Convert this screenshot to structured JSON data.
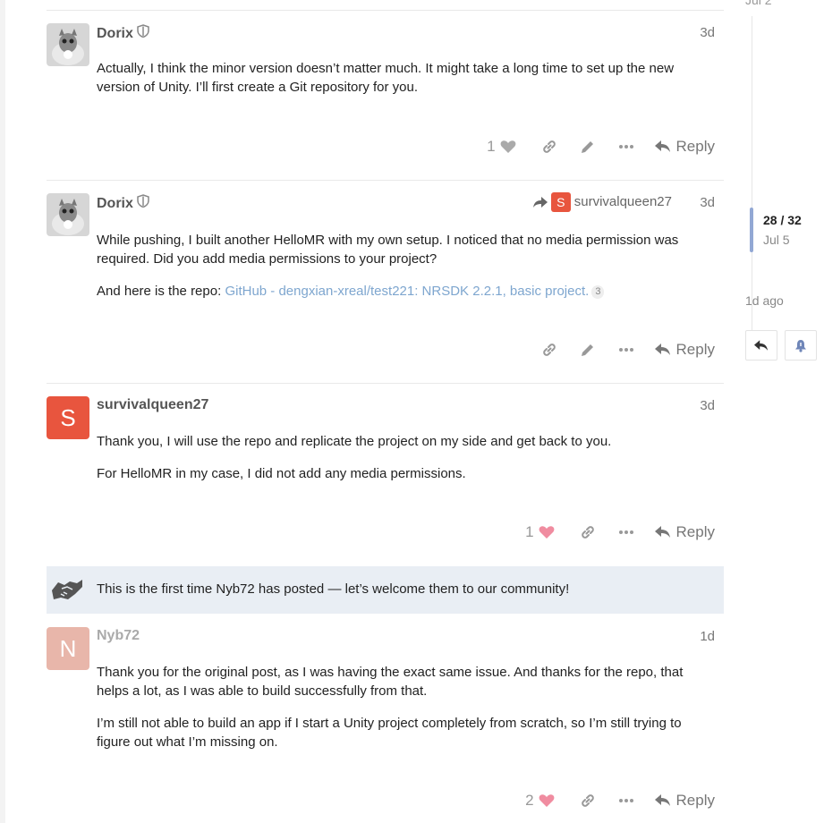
{
  "timeline": {
    "top_date": "Jul 2",
    "count": "28 / 32",
    "date": "Jul 5",
    "last_activity": "1d ago"
  },
  "posts": [
    {
      "username": "Dorix",
      "date": "3d",
      "paragraphs": [
        "Actually, I think the minor version doesn’t matter much. It might take a long time to set up the new version of Unity. I’ll first create a Git repository for you."
      ],
      "likes": "1",
      "reply_label": "Reply"
    },
    {
      "username": "Dorix",
      "date": "3d",
      "reply_to": {
        "initial": "S",
        "username": "survivalqueen27"
      },
      "paragraphs": [
        "While pushing, I built another HelloMR with my own setup. I noticed that no media permission was required. Did you add media permissions to your project?"
      ],
      "repo_prefix": "And here is the repo: ",
      "repo_link": "GitHub - dengxian-xreal/test221: NRSDK 2.2.1, basic project.",
      "repo_clicks": "3",
      "reply_label": "Reply"
    },
    {
      "username": "survivalqueen27",
      "avatar_letter": "S",
      "date": "3d",
      "paragraphs": [
        "Thank you, I will use the repo and replicate the project on my side and get back to you.",
        "For HelloMR in my case, I did not add any media permissions."
      ],
      "likes": "1",
      "reply_label": "Reply"
    },
    {
      "username": "Nyb72",
      "avatar_letter": "N",
      "date": "1d",
      "paragraphs": [
        "Thank you for the original post, as I was having the exact same issue. And thanks for the repo, that helps a lot, as I was able to build successfully from that.",
        "I’m still not able to build an app if I start a Unity project completely from scratch, so I’m still trying to figure out what I’m missing on."
      ],
      "likes": "2",
      "reply_label": "Reply"
    }
  ],
  "first_post_notice": "This is the first time Nyb72 has posted — let’s welcome them to our community!",
  "colors": {
    "accent_red": "#e8553e",
    "avatar_n": "#e8b6aa",
    "link": "#7ea6cf",
    "heart_liked": "#f08ca0",
    "heart_plain": "#aaaaaa",
    "notice_bg": "#e9eef4",
    "timeline_handle": "#92a8d4"
  },
  "icons": [
    "shield-icon",
    "heart-icon",
    "link-icon",
    "pencil-icon",
    "ellipsis-icon",
    "reply-icon",
    "share-arrow-icon",
    "handshake-icon",
    "bell-icon"
  ]
}
